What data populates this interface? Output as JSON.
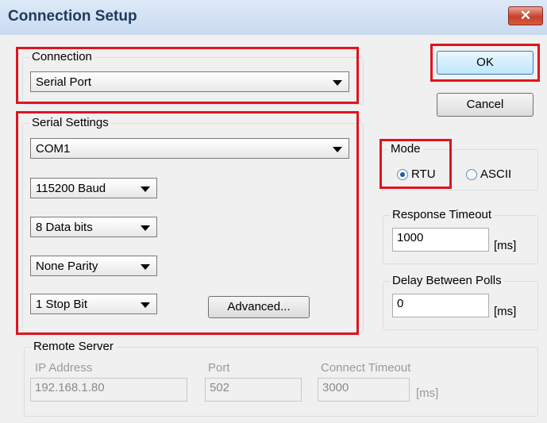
{
  "window": {
    "title": "Connection Setup",
    "close_glyph": "✕"
  },
  "connection": {
    "legend": "Connection",
    "selected": "Serial Port"
  },
  "buttons": {
    "ok": "OK",
    "cancel": "Cancel",
    "advanced": "Advanced..."
  },
  "serial": {
    "legend": "Serial Settings",
    "port": "COM1",
    "baud": "115200 Baud",
    "data_bits": "8 Data bits",
    "parity": "None Parity",
    "stop_bits": "1 Stop Bit"
  },
  "mode": {
    "legend": "Mode",
    "options": [
      "RTU",
      "ASCII"
    ],
    "selected": "RTU"
  },
  "response_timeout": {
    "legend": "Response Timeout",
    "value": "1000",
    "unit": "[ms]"
  },
  "delay_between_polls": {
    "legend": "Delay Between Polls",
    "value": "0",
    "unit": "[ms]"
  },
  "remote_server": {
    "legend": "Remote Server",
    "ip_label": "IP Address",
    "ip_value": "192.168.1.80",
    "port_label": "Port",
    "port_value": "502",
    "timeout_label": "Connect Timeout",
    "timeout_value": "3000",
    "timeout_unit": "[ms]"
  },
  "colors": {
    "highlight": "#e0141e",
    "title_text": "#1e395b",
    "close_button": "#c7402a"
  },
  "icons": {
    "close": "close-icon",
    "dropdown": "chevron-down-icon"
  }
}
